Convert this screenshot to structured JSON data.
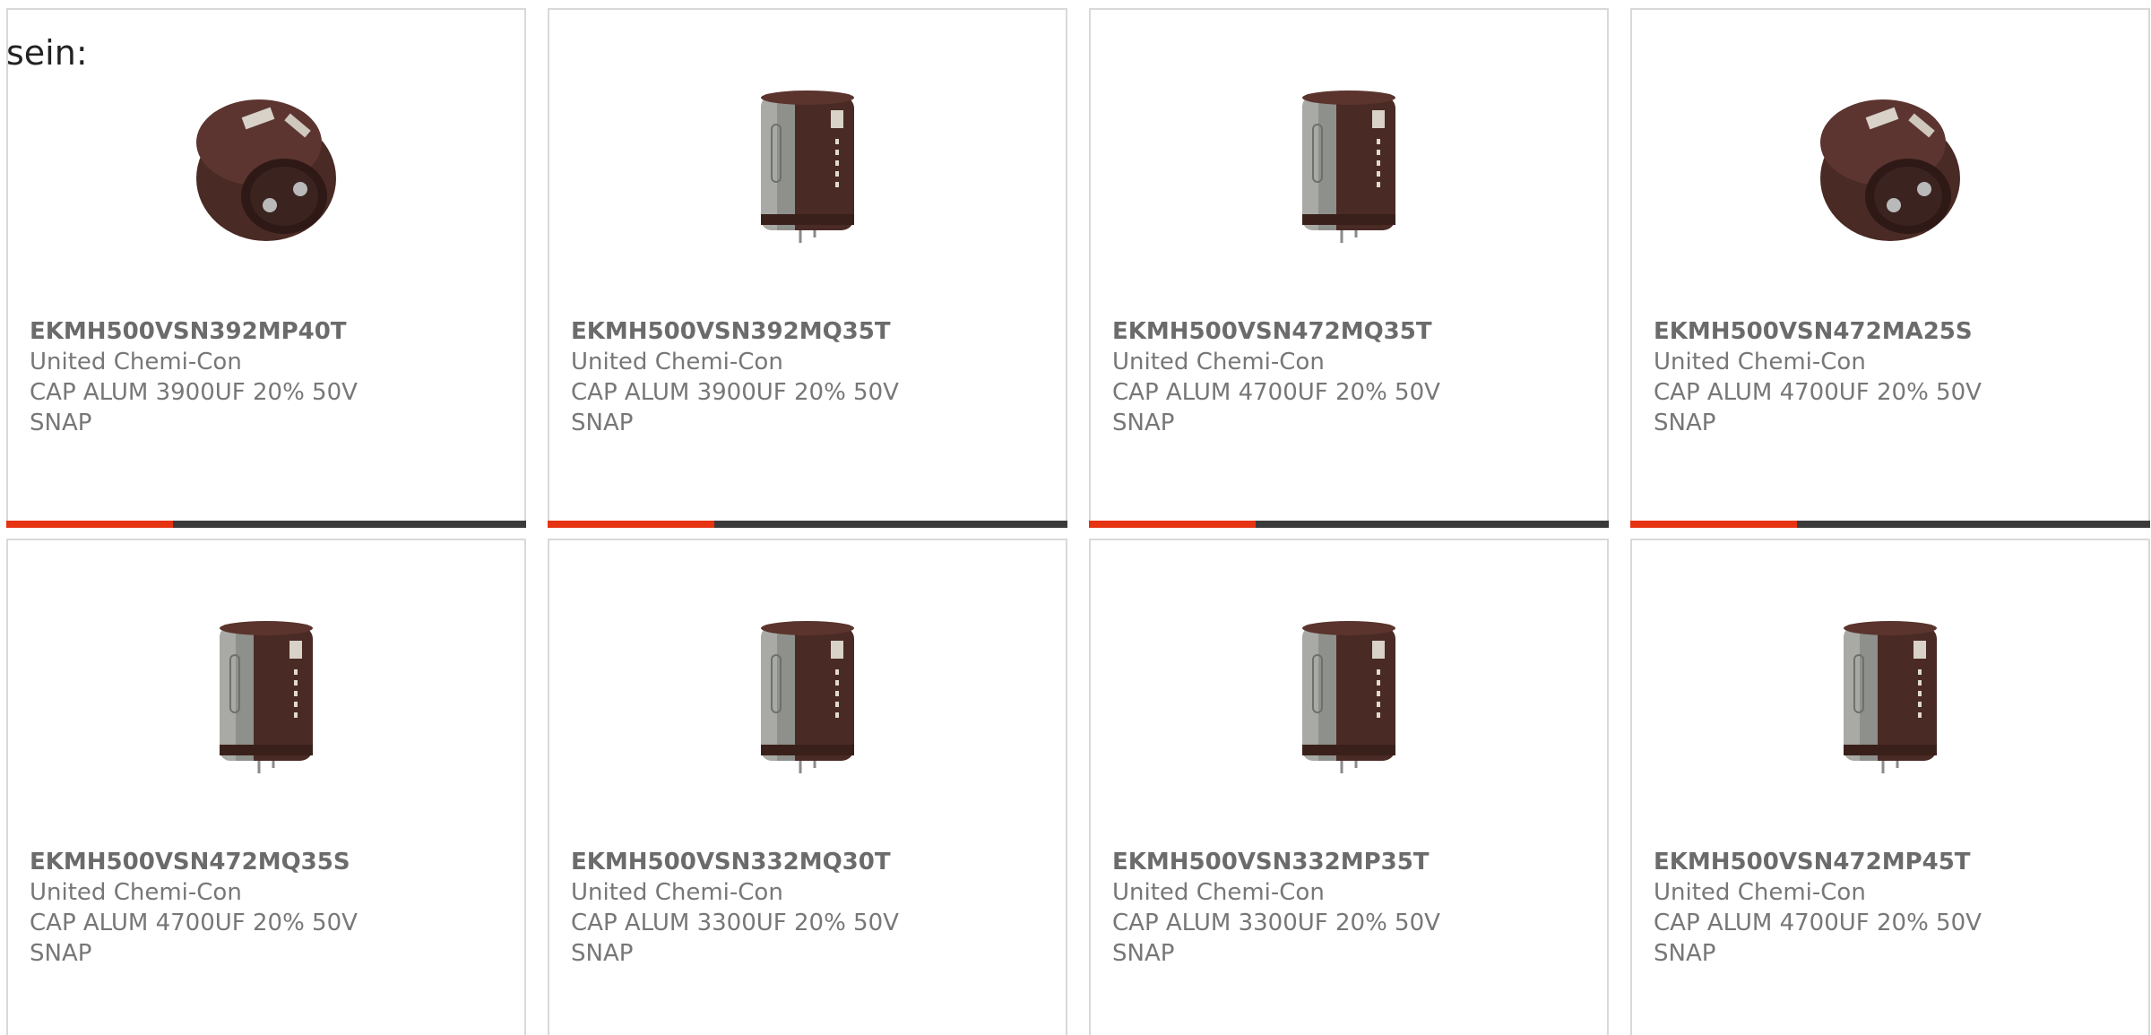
{
  "intro_text": "sein:",
  "colors": {
    "accent": "#e63312",
    "bar_dark": "#3a3a3a",
    "card_border": "#d9d9d9",
    "text": "#666666"
  },
  "products": [
    {
      "part_number": "EKMH500VSN392MP40T",
      "manufacturer": "United Chemi-Con",
      "description": "CAP ALUM 3900UF 20% 50V SNAP",
      "image": "capacitor-snap-angled-icon",
      "show_bar": true
    },
    {
      "part_number": "EKMH500VSN392MQ35T",
      "manufacturer": "United Chemi-Con",
      "description": "CAP ALUM 3900UF 20% 50V SNAP",
      "image": "capacitor-upright-icon",
      "show_bar": true
    },
    {
      "part_number": "EKMH500VSN472MQ35T",
      "manufacturer": "United Chemi-Con",
      "description": "CAP ALUM 4700UF 20% 50V SNAP",
      "image": "capacitor-upright-icon",
      "show_bar": true
    },
    {
      "part_number": "EKMH500VSN472MA25S",
      "manufacturer": "United Chemi-Con",
      "description": "CAP ALUM 4700UF 20% 50V SNAP",
      "image": "capacitor-snap-angled-icon",
      "show_bar": true
    },
    {
      "part_number": "EKMH500VSN472MQ35S",
      "manufacturer": "United Chemi-Con",
      "description": "CAP ALUM 4700UF 20% 50V SNAP",
      "image": "capacitor-upright-icon",
      "show_bar": false
    },
    {
      "part_number": "EKMH500VSN332MQ30T",
      "manufacturer": "United Chemi-Con",
      "description": "CAP ALUM 3300UF 20% 50V SNAP",
      "image": "capacitor-upright-icon",
      "show_bar": false
    },
    {
      "part_number": "EKMH500VSN332MP35T",
      "manufacturer": "United Chemi-Con",
      "description": "CAP ALUM 3300UF 20% 50V SNAP",
      "image": "capacitor-upright-icon",
      "show_bar": false
    },
    {
      "part_number": "EKMH500VSN472MP45T",
      "manufacturer": "United Chemi-Con",
      "description": "CAP ALUM 4700UF 20% 50V SNAP",
      "image": "capacitor-upright-icon",
      "show_bar": false
    }
  ]
}
